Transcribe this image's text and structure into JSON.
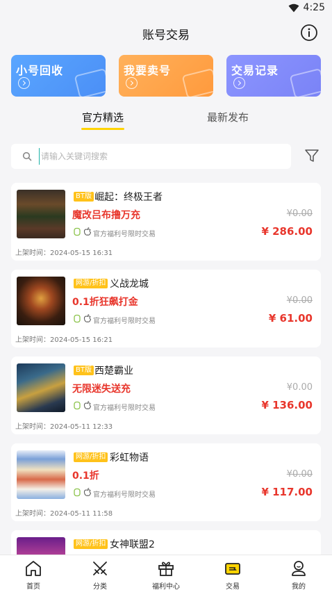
{
  "status": {
    "time": "4:25"
  },
  "header": {
    "title": "账号交易"
  },
  "quick_cards": [
    {
      "label": "小号回收",
      "color_from": "#5aa6ff",
      "color_to": "#4b8ff6"
    },
    {
      "label": "我要卖号",
      "color_from": "#ffb15b",
      "color_to": "#ff9a3d"
    },
    {
      "label": "交易记录",
      "color_from": "#8c95ff",
      "color_to": "#7a83f6"
    }
  ],
  "tabs": [
    {
      "label": "官方精选",
      "active": true
    },
    {
      "label": "最新发布",
      "active": false
    }
  ],
  "search": {
    "placeholder": "请输入关键词搜索"
  },
  "items": [
    {
      "tag": "BT版",
      "name": "崛起：终极王者",
      "promo": "魔改吕布撸万充",
      "note": "官方福利号限时交易",
      "original_price": "¥0.00",
      "price": "¥ 286.00",
      "date": "上架时间：2024-05-15 16:31"
    },
    {
      "tag": "网游/折扣",
      "name": "义战龙城",
      "promo": "0.1折狂飙打金",
      "note": "官方福利号限时交易",
      "original_price": "¥0.00",
      "price": "¥ 61.00",
      "date": "上架时间：2024-05-15 16:21"
    },
    {
      "tag": "BT版",
      "name": "西楚霸业",
      "promo": "无限迷失送充",
      "note": "官方福利号限时交易",
      "original_price": "¥0.00",
      "price": "¥ 136.00",
      "date": "上架时间：2024-05-11 12:33"
    },
    {
      "tag": "网游/折扣",
      "name": "彩虹物语",
      "promo": "0.1折",
      "note": "官方福利号限时交易",
      "original_price": "¥0.00",
      "price": "¥ 117.00",
      "date": "上架时间：2024-05-11 11:58"
    },
    {
      "tag": "网游/折扣",
      "name": "女神联盟2",
      "promo": "",
      "note": "",
      "original_price": "",
      "price": "",
      "date": ""
    }
  ],
  "bottom_nav": [
    {
      "label": "首页",
      "icon": "home-icon"
    },
    {
      "label": "分类",
      "icon": "swords-icon"
    },
    {
      "label": "福利中心",
      "icon": "gift-icon"
    },
    {
      "label": "交易",
      "icon": "trade-icon",
      "active": true
    },
    {
      "label": "我的",
      "icon": "profile-icon"
    }
  ],
  "colors": {
    "accent": "#ffd400",
    "price": "#e8362c",
    "tag": "#ffc21a"
  }
}
